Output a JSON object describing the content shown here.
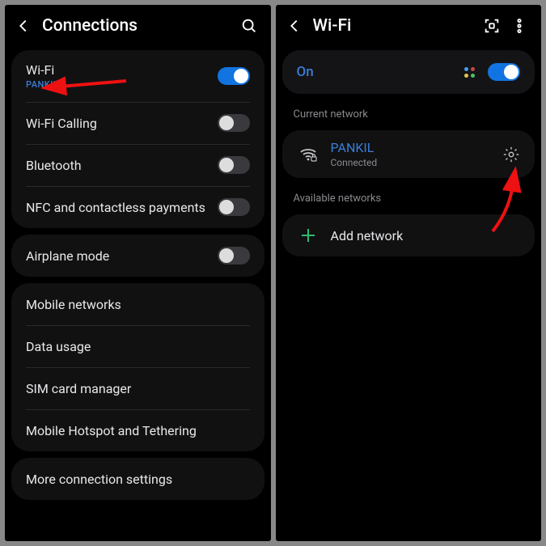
{
  "left": {
    "title": "Connections",
    "items": {
      "wifi": {
        "label": "Wi-Fi",
        "sub": "PANKIL",
        "on": true
      },
      "wificalling": {
        "label": "Wi-Fi Calling",
        "on": false
      },
      "bluetooth": {
        "label": "Bluetooth",
        "on": false
      },
      "nfc": {
        "label": "NFC and contactless payments",
        "on": false
      },
      "airplane": {
        "label": "Airplane mode",
        "on": false
      },
      "mobilenet": {
        "label": "Mobile networks"
      },
      "datausage": {
        "label": "Data usage"
      },
      "sim": {
        "label": "SIM card manager"
      },
      "hotspot": {
        "label": "Mobile Hotspot and Tethering"
      },
      "more": {
        "label": "More connection settings"
      }
    }
  },
  "right": {
    "title": "Wi-Fi",
    "on_label": "On",
    "current_header": "Current network",
    "current": {
      "name": "PANKIL",
      "status": "Connected"
    },
    "available_header": "Available networks",
    "add_label": "Add network"
  }
}
